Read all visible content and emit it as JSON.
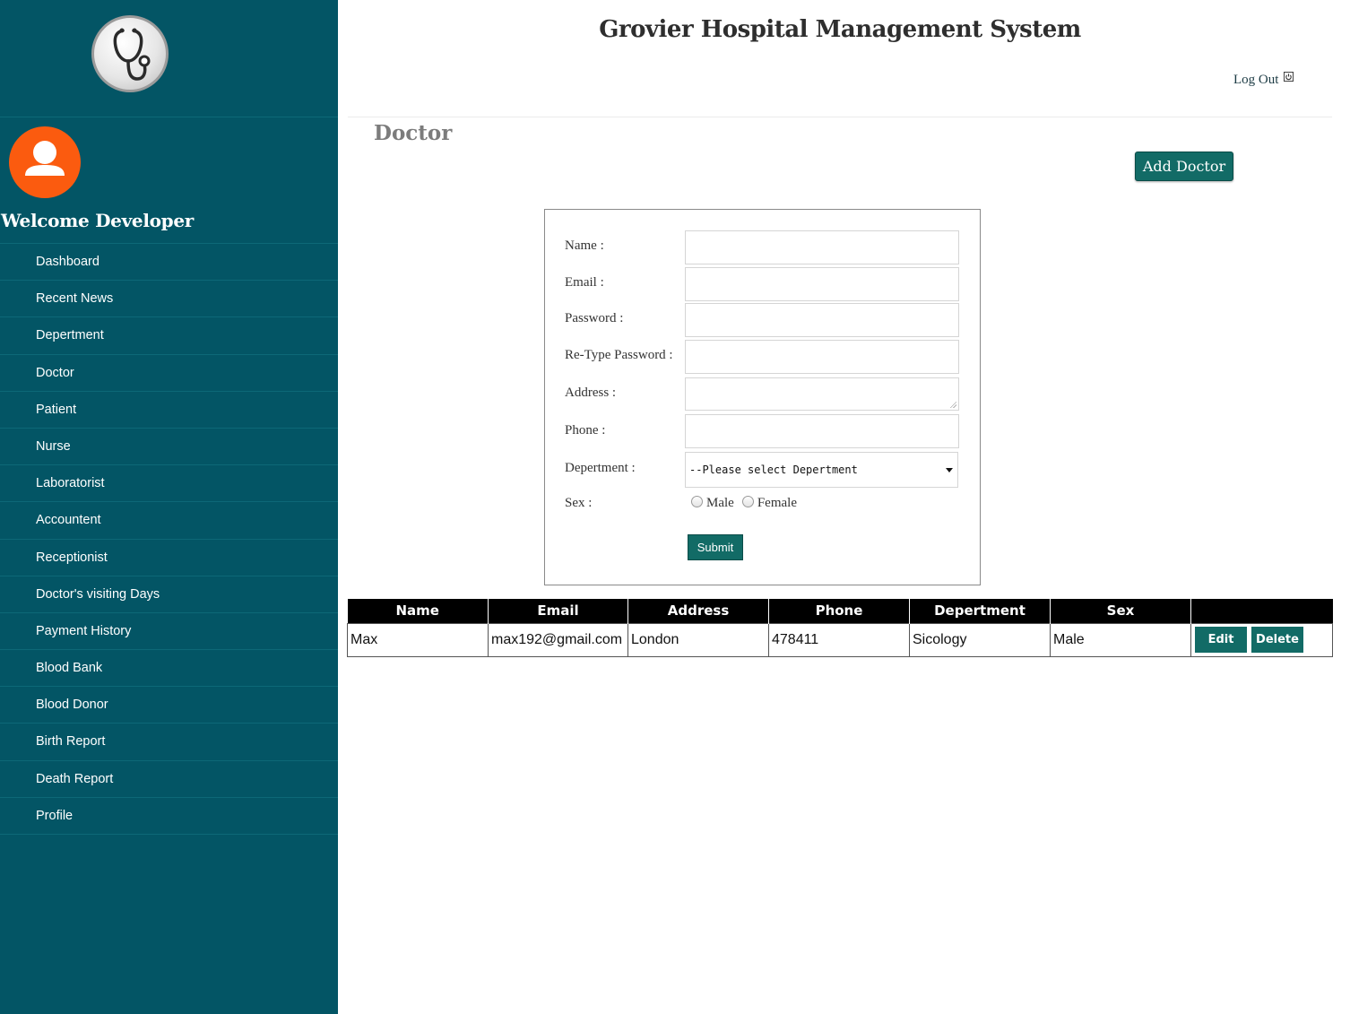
{
  "app": {
    "title": "Grovier Hospital Management System",
    "logout_label": "Log Out"
  },
  "sidebar": {
    "logo_icon": "stethoscope-icon",
    "avatar_icon": "user-icon",
    "welcome": "Welcome Developer",
    "items": [
      {
        "label": "Dashboard"
      },
      {
        "label": "Recent News"
      },
      {
        "label": "Depertment"
      },
      {
        "label": "Doctor"
      },
      {
        "label": "Patient"
      },
      {
        "label": "Nurse"
      },
      {
        "label": "Laboratorist"
      },
      {
        "label": "Accountent"
      },
      {
        "label": "Receptionist"
      },
      {
        "label": "Doctor's visiting Days"
      },
      {
        "label": "Payment History"
      },
      {
        "label": "Blood Bank"
      },
      {
        "label": "Blood Donor"
      },
      {
        "label": "Birth Report"
      },
      {
        "label": "Death Report"
      },
      {
        "label": "Profile"
      }
    ]
  },
  "page": {
    "heading": "Doctor",
    "add_button": "Add Doctor"
  },
  "form": {
    "labels": {
      "name": "Name :",
      "email": "Email :",
      "password": "Password :",
      "retype_password": "Re-Type Password :",
      "address": "Address :",
      "phone": "Phone :",
      "department": "Depertment :",
      "sex": "Sex :"
    },
    "values": {
      "name": "",
      "email": "",
      "password": "",
      "retype_password": "",
      "address": "",
      "phone": ""
    },
    "department_selected": "--Please select Depertment",
    "sex_options": [
      "Male",
      "Female"
    ],
    "submit_label": "Submit"
  },
  "table": {
    "headers": [
      "Name",
      "Email",
      "Address",
      "Phone",
      "Depertment",
      "Sex",
      ""
    ],
    "rows": [
      {
        "name": "Max",
        "email": "max192@gmail.com",
        "address": "London",
        "phone": "478411",
        "department": "Sicology",
        "sex": "Male"
      }
    ],
    "edit_label": "Edit",
    "delete_label": "Delete"
  },
  "colors": {
    "sidebar_bg": "#035565",
    "accent_button": "#126b66",
    "avatar_bg": "#fb5b0f",
    "table_header_bg": "#000000"
  }
}
